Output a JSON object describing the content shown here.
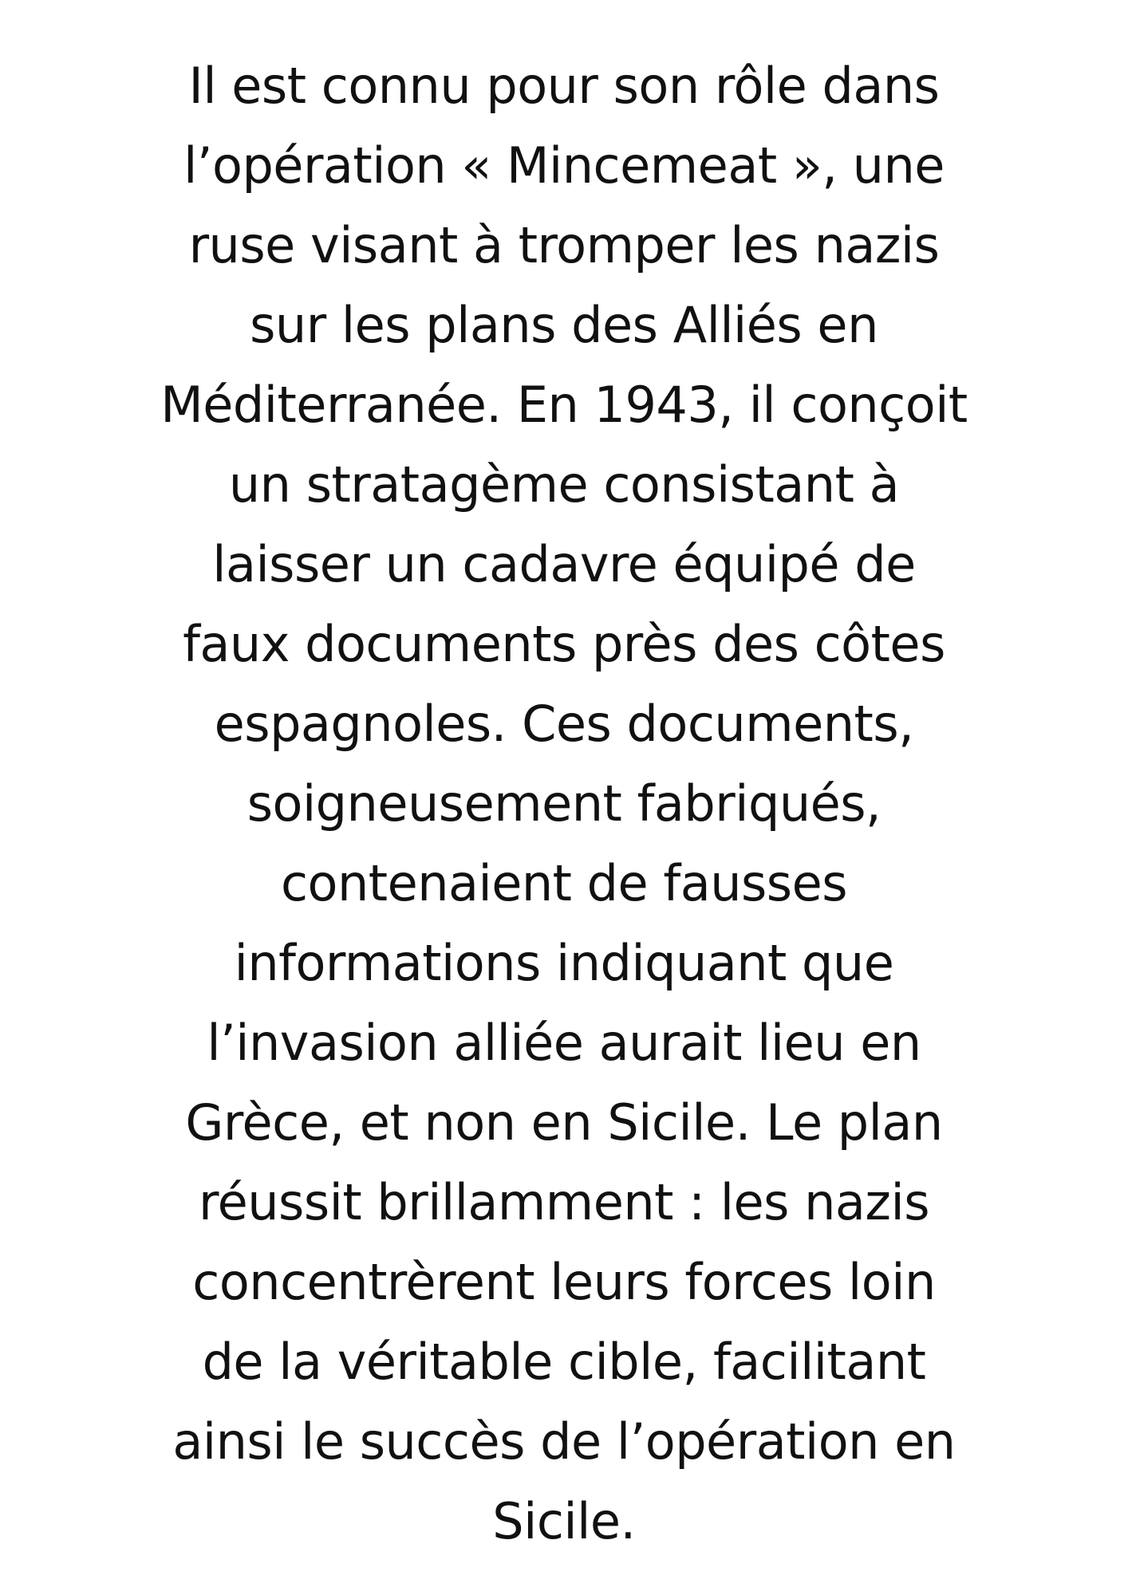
{
  "body": {
    "lines": [
      "Il est connu pour son rôle dans",
      "l’opération « Mincemeat », une",
      "ruse visant à tromper les nazis",
      "sur les plans des Alliés en",
      "Méditerranée. En 1943, il conçoit",
      "un stratagème consistant à",
      "laisser un cadavre équipé de",
      "faux documents près des côtes",
      "espagnoles. Ces documents,",
      "soigneusement fabriqués,",
      "contenaient de fausses",
      "informations indiquant que",
      "l’invasion alliée aurait lieu en",
      "Grèce, et non en Sicile. Le plan",
      "réussit brillamment : les nazis",
      "concentrèrent leurs forces loin",
      "de la véritable cible, facilitant",
      "ainsi le succès de l’opération en",
      "Sicile."
    ]
  }
}
